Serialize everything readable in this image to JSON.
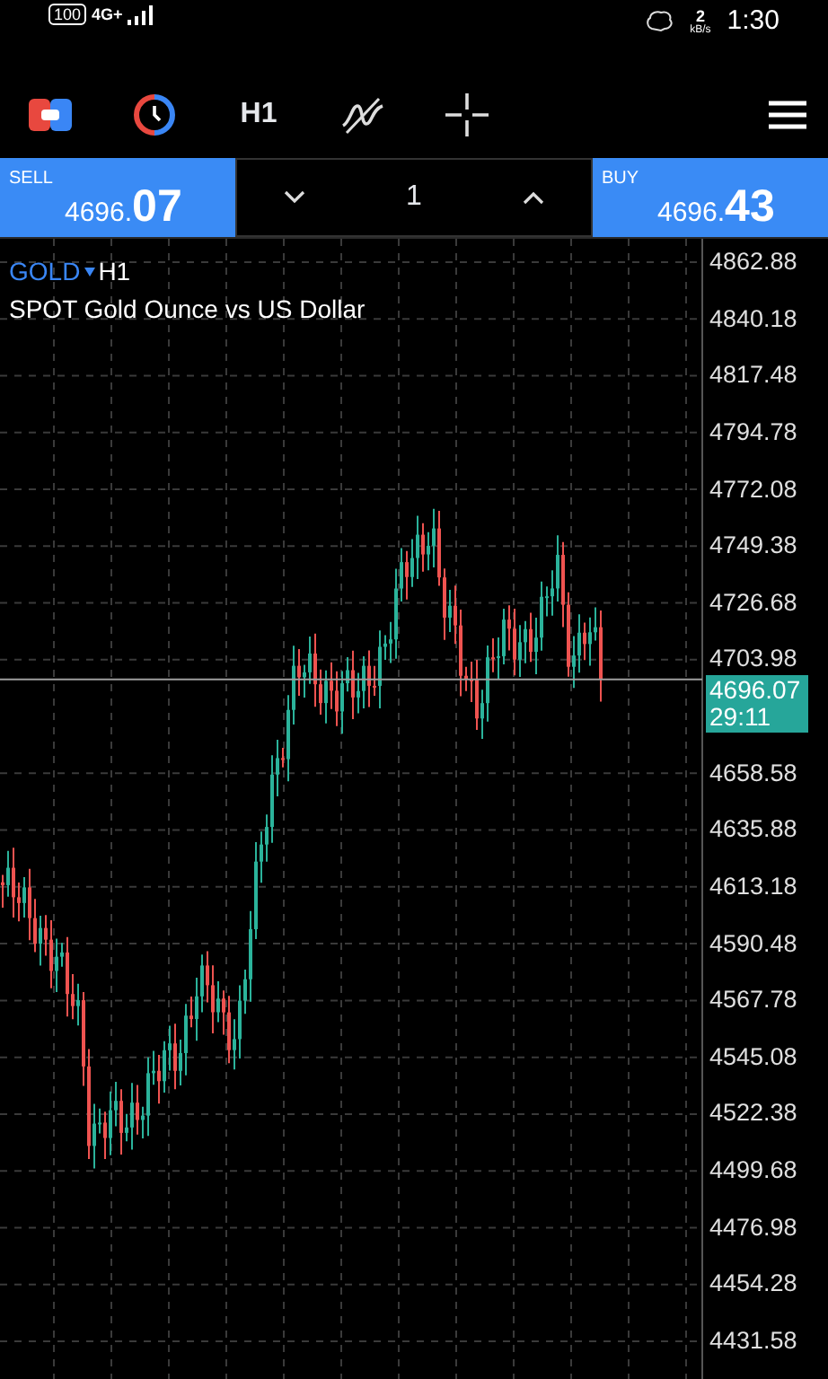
{
  "status_bar": {
    "battery": "100",
    "network": "4G+",
    "speed_value": "2",
    "speed_unit": "kB/s",
    "time": "1:30"
  },
  "toolbar": {
    "timeframe": "H1"
  },
  "trade_panel": {
    "sell": {
      "label": "SELL",
      "price_main": "4696.",
      "price_big": "07"
    },
    "volume": "1",
    "buy": {
      "label": "BUY",
      "price_main": "4696.",
      "price_big": "43"
    }
  },
  "chart": {
    "symbol": "GOLD",
    "timeframe": "H1",
    "description": "SPOT Gold Ounce vs US Dollar",
    "price_axis": [
      "4862.88",
      "4840.18",
      "4817.48",
      "4794.78",
      "4772.08",
      "4749.38",
      "4726.68",
      "4703.98",
      "4658.58",
      "4635.88",
      "4613.18",
      "4590.48",
      "4567.78",
      "4545.08",
      "4522.38",
      "4499.68",
      "4476.98",
      "4454.28",
      "4431.58"
    ],
    "current_price": "4696.07",
    "bar_countdown": "29:11"
  }
}
